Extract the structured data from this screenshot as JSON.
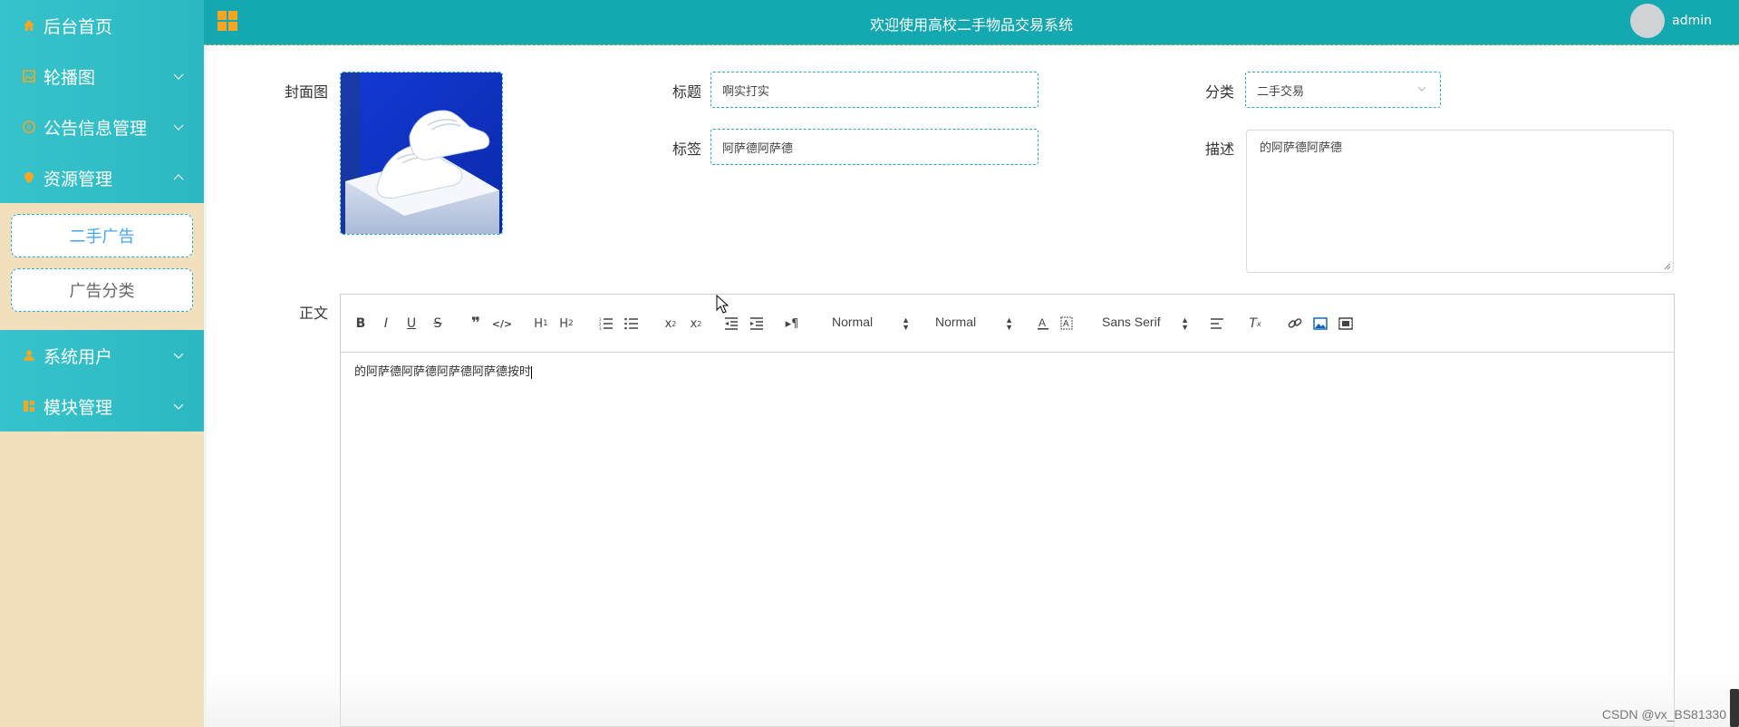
{
  "header": {
    "title": "欢迎使用高校二手物品交易系统",
    "username": "admin"
  },
  "sidebar": {
    "items": [
      {
        "label": "后台首页",
        "icon": "home-icon"
      },
      {
        "label": "轮播图",
        "icon": "image-icon"
      },
      {
        "label": "公告信息管理",
        "icon": "info-icon"
      },
      {
        "label": "资源管理",
        "icon": "location-icon"
      },
      {
        "label": "系统用户",
        "icon": "user-icon"
      },
      {
        "label": "模块管理",
        "icon": "module-icon"
      }
    ],
    "sub_items": [
      "二手广告",
      "广告分类"
    ]
  },
  "form": {
    "cover_label": "封面图",
    "title_label": "标题",
    "title_value": "啊实打实",
    "tag_label": "标签",
    "tag_value": "阿萨德阿萨德",
    "category_label": "分类",
    "category_value": "二手交易",
    "desc_label": "描述",
    "desc_value": "的阿萨德阿萨德",
    "body_label": "正文"
  },
  "editor": {
    "size_select": "Normal",
    "header_select": "Normal",
    "font_select": "Sans Serif",
    "content": "的阿萨德阿萨德阿萨德阿萨德按时"
  },
  "watermark": "CSDN @vx_BS81330",
  "colors": {
    "sidebar_menu": "#2bb8c1",
    "header": "#14a8b1",
    "sidebar_bg": "#f2dfbd",
    "accent_icon": "#f6a623",
    "dashed_border": "#2aa8c6"
  }
}
